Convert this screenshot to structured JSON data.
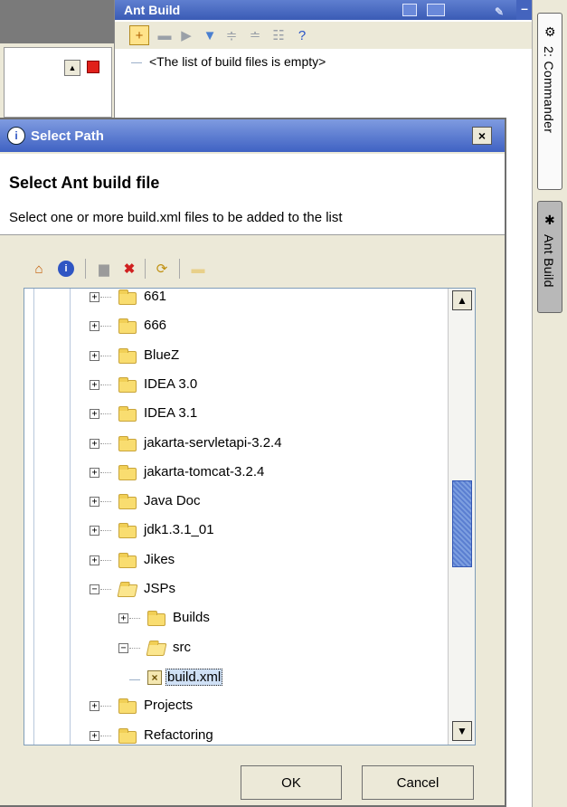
{
  "ant_build": {
    "title": "Ant Build",
    "empty_message": "<The list of build files is empty>",
    "toolbar_icons": [
      "add-icon",
      "remove-icon",
      "run-icon",
      "filter-icon",
      "expand-all-icon",
      "collapse-all-icon",
      "properties-icon",
      "help-icon"
    ]
  },
  "side_tabs": {
    "commander": "2: Commander",
    "ant_build": "Ant Build"
  },
  "dialog": {
    "title": "Select Path",
    "close_label": "×",
    "header_title": "Select Ant build file",
    "header_description": "Select one or more build.xml files to be added to the list",
    "toolbar_icons": [
      "home-icon",
      "project-icon",
      "new-folder-icon",
      "delete-icon",
      "refresh-icon",
      "show-hidden-icon"
    ],
    "tree": [
      {
        "label": "661",
        "expanded": false
      },
      {
        "label": "666",
        "expanded": false
      },
      {
        "label": "BlueZ",
        "expanded": false
      },
      {
        "label": "IDEA 3.0",
        "expanded": false
      },
      {
        "label": "IDEA 3.1",
        "expanded": false
      },
      {
        "label": "jakarta-servletapi-3.2.4",
        "expanded": false
      },
      {
        "label": "jakarta-tomcat-3.2.4",
        "expanded": false
      },
      {
        "label": "Java Doc",
        "expanded": false
      },
      {
        "label": "jdk1.3.1_01",
        "expanded": false
      },
      {
        "label": "Jikes",
        "expanded": false
      },
      {
        "label": "JSPs",
        "expanded": true
      },
      {
        "label": "Builds",
        "expanded": false
      },
      {
        "label": "src",
        "expanded": true
      },
      {
        "label": "build.xml",
        "selected": true
      },
      {
        "label": "Projects",
        "expanded": false
      },
      {
        "label": "Refactoring",
        "expanded": false
      }
    ],
    "buttons": {
      "ok": "OK",
      "cancel": "Cancel"
    }
  }
}
